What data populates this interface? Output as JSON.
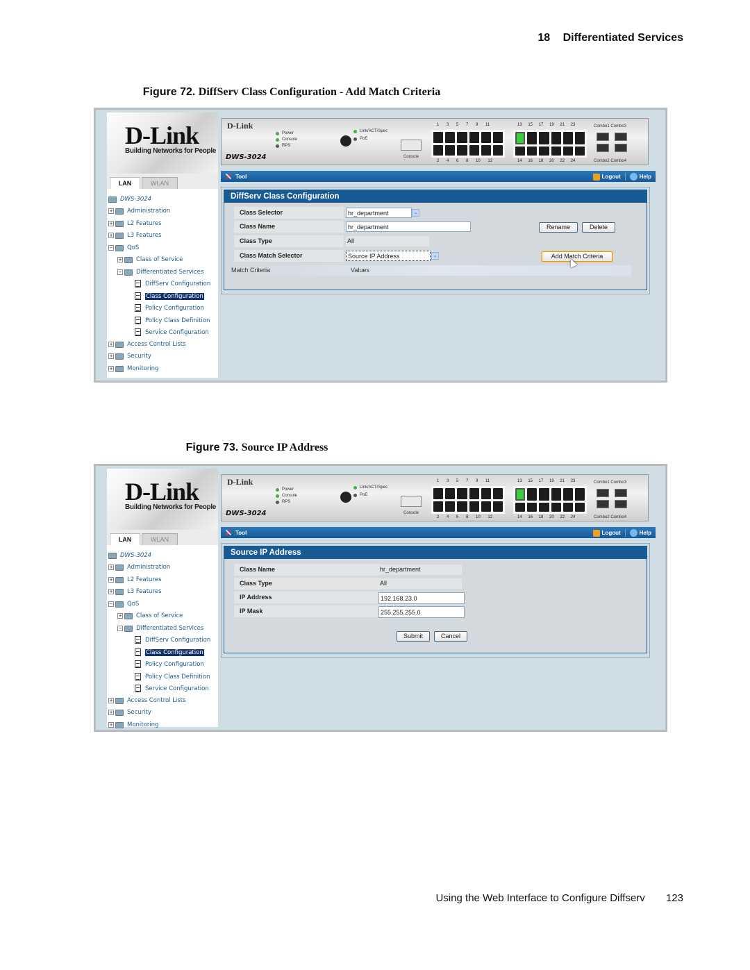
{
  "page_header": {
    "chapter_number": "18",
    "chapter_title": "Differentiated Services"
  },
  "figures": [
    {
      "label": "Figure 72.",
      "title": "DiffServ Class Configuration - Add Match Criteria"
    },
    {
      "label": "Figure 73.",
      "title": "Source IP Address"
    }
  ],
  "footer": {
    "text": "Using the Web Interface to Configure Diffserv",
    "page_number": "123"
  },
  "app": {
    "logo": {
      "brand": "D-Link",
      "tagline": "Building Networks for People"
    },
    "tabs": [
      "LAN",
      "WLAN"
    ],
    "switch": {
      "brand": "D-Link",
      "model": "DWS-3024",
      "leds_left": [
        "Power",
        "Console",
        "RPS"
      ],
      "leds_right": [
        "Link/ACT/Spec",
        "PoE"
      ],
      "console_label": "Console",
      "top_ports_a": [
        "1",
        "3",
        "5",
        "7",
        "9",
        "11"
      ],
      "top_ports_b": [
        "13",
        "15",
        "17",
        "19",
        "21",
        "23"
      ],
      "bottom_ports_a": [
        "2",
        "4",
        "6",
        "8",
        "10",
        "12"
      ],
      "bottom_ports_b": [
        "14",
        "16",
        "18",
        "20",
        "22",
        "24"
      ],
      "combo_top": "Combo1 Combo3",
      "combo_bottom": "Combo2 Combo4"
    },
    "toolbar": {
      "tool": "Tool",
      "logout": "Logout",
      "help": "Help"
    },
    "tree": {
      "root": "DWS-3024",
      "items": [
        "Administration",
        "L2 Features",
        "L3 Features",
        "QoS"
      ],
      "qos_children": [
        "Class of Service",
        "Differentiated Services"
      ],
      "diffserv_children": [
        "DiffServ Configuration",
        "Class Configuration",
        "Policy Configuration",
        "Policy Class Definition",
        "Service Configuration"
      ],
      "selected": "Class Configuration",
      "bottom_items": [
        "Access Control Lists",
        "Security",
        "Monitoring"
      ]
    }
  },
  "fig72_panel": {
    "title": "DiffServ Class Configuration",
    "class_selector_label": "Class Selector",
    "class_selector_value": "hr_department",
    "class_name_label": "Class Name",
    "class_name_value": "hr_department",
    "class_type_label": "Class Type",
    "class_type_value": "All",
    "class_match_selector_label": "Class Match Selector",
    "class_match_selector_value": "Source IP Address",
    "match_criteria_header": "Match Criteria",
    "values_header": "Values",
    "rename_button": "Rename",
    "delete_button": "Delete",
    "add_match_button": "Add Match Criteria"
  },
  "fig73_panel": {
    "title": "Source IP Address",
    "class_name_label": "Class Name",
    "class_name_value": "hr_department",
    "class_type_label": "Class Type",
    "class_type_value": "All",
    "ip_address_label": "IP Address",
    "ip_address_value": "192.168.23.0",
    "ip_mask_label": "IP Mask",
    "ip_mask_value": "255.255.255.0",
    "submit_button": "Submit",
    "cancel_button": "Cancel"
  }
}
